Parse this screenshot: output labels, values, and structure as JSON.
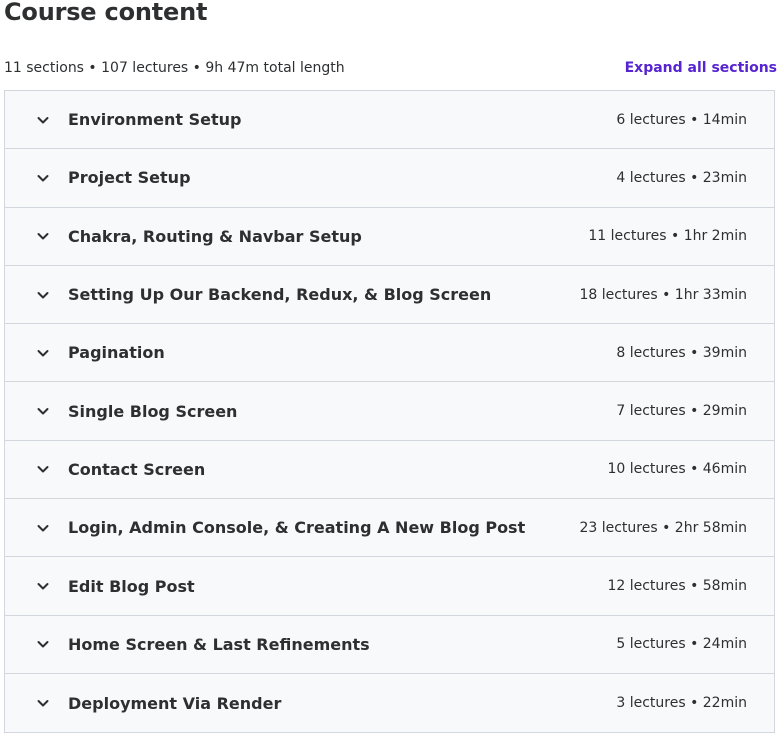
{
  "header": {
    "title": "Course content",
    "summary": "11 sections • 107 lectures • 9h 47m total length",
    "expand_all_label": "Expand all sections"
  },
  "colors": {
    "accent": "#5624d0",
    "row_background": "#f7f9fa",
    "border": "#d1d7dc",
    "text": "#2d2f31"
  },
  "sections": [
    {
      "title": "Environment Setup",
      "meta": "6 lectures • 14min",
      "icon": "chevron-down-icon"
    },
    {
      "title": "Project Setup",
      "meta": "4 lectures • 23min",
      "icon": "chevron-down-icon"
    },
    {
      "title": "Chakra, Routing & Navbar Setup",
      "meta": "11 lectures • 1hr 2min",
      "icon": "chevron-down-icon"
    },
    {
      "title": "Setting Up Our Backend, Redux, & Blog Screen",
      "meta": "18 lectures • 1hr 33min",
      "icon": "chevron-down-icon"
    },
    {
      "title": "Pagination",
      "meta": "8 lectures • 39min",
      "icon": "chevron-down-icon"
    },
    {
      "title": "Single Blog Screen",
      "meta": "7 lectures • 29min",
      "icon": "chevron-down-icon"
    },
    {
      "title": "Contact Screen",
      "meta": "10 lectures • 46min",
      "icon": "chevron-down-icon"
    },
    {
      "title": "Login, Admin Console, & Creating A New Blog Post",
      "meta": "23 lectures • 2hr 58min",
      "icon": "chevron-down-icon"
    },
    {
      "title": "Edit Blog Post",
      "meta": "12 lectures • 58min",
      "icon": "chevron-down-icon"
    },
    {
      "title": "Home Screen & Last Refinements",
      "meta": "5 lectures • 24min",
      "icon": "chevron-down-icon"
    },
    {
      "title": "Deployment Via Render",
      "meta": "3 lectures • 22min",
      "icon": "chevron-down-icon"
    }
  ]
}
